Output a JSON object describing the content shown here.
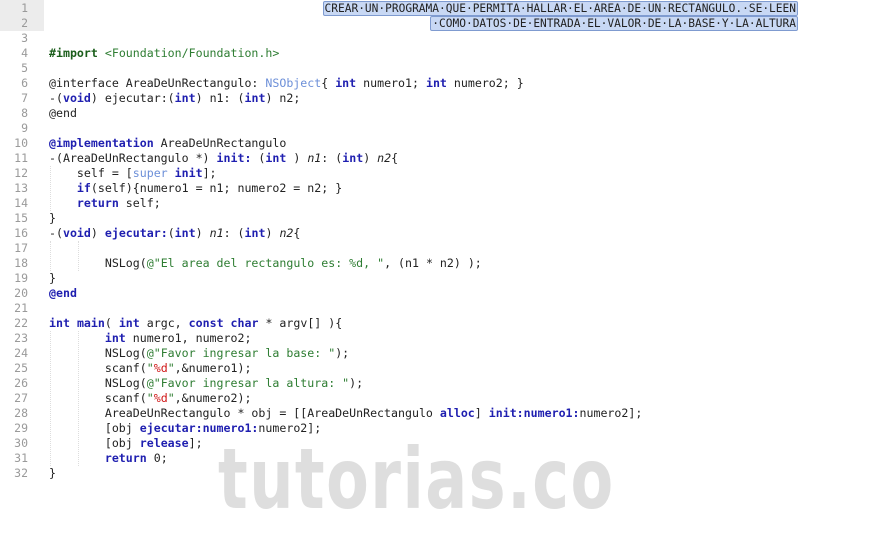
{
  "editor": {
    "header_comment": [
      "CREAR·UN·PROGRAMA·QUE·PERMITA·HALLAR·EL·AREA·DE·UN·RECTANGULO.·SE·LEEN",
      "·COMO·DATOS·DE·ENTRADA·EL·VALOR·DE·LA·BASE·Y·LA·ALTURA"
    ],
    "colors": {
      "keyword": "#1f1fb0",
      "string": "#2e7d32",
      "type": "#6c8fd8",
      "format": "#d01515",
      "comment_bg": "#c8d8f4"
    },
    "lines": [
      {
        "n": "1",
        "tokens": []
      },
      {
        "n": "2",
        "tokens": []
      },
      {
        "n": "3",
        "tokens": []
      },
      {
        "n": "4",
        "tokens": [
          [
            "p",
            "#import"
          ],
          [
            "",
            ""
          ],
          [
            "s",
            " <Foundation/Foundation.h>"
          ]
        ]
      },
      {
        "n": "5",
        "tokens": []
      },
      {
        "n": "6",
        "tokens": [
          [
            "",
            "@interface AreaDeUnRectangulo: "
          ],
          [
            "t",
            "NSObject"
          ],
          [
            "",
            "{ "
          ],
          [
            "k",
            "int"
          ],
          [
            "",
            " numero1; "
          ],
          [
            "k",
            "int"
          ],
          [
            "",
            " numero2; }"
          ]
        ]
      },
      {
        "n": "7",
        "tokens": [
          [
            "",
            "-("
          ],
          [
            "k",
            "void"
          ],
          [
            "",
            ") ejecutar:("
          ],
          [
            "k",
            "int"
          ],
          [
            "",
            ") n1: ("
          ],
          [
            "k",
            "int"
          ],
          [
            "",
            ") n2;"
          ]
        ]
      },
      {
        "n": "8",
        "tokens": [
          [
            "",
            "@end"
          ]
        ]
      },
      {
        "n": "9",
        "tokens": []
      },
      {
        "n": "10",
        "tokens": [
          [
            "k",
            "@implementation"
          ],
          [
            "",
            " AreaDeUnRectangulo"
          ]
        ]
      },
      {
        "n": "11",
        "tokens": [
          [
            "",
            "-(AreaDeUnRectangulo *) "
          ],
          [
            "k",
            "init:"
          ],
          [
            "",
            " ("
          ],
          [
            "k",
            "int"
          ],
          [
            "",
            " ) "
          ],
          [
            "i",
            "n1"
          ],
          [
            "",
            ": ("
          ],
          [
            "k",
            "int"
          ],
          [
            "",
            ") "
          ],
          [
            "i",
            "n2"
          ],
          [
            "",
            "{"
          ]
        ]
      },
      {
        "n": "12",
        "tokens": [
          [
            "",
            "    self = ["
          ],
          [
            "t",
            "super"
          ],
          [
            "",
            " "
          ],
          [
            "k",
            "init"
          ],
          [
            "",
            "];"
          ]
        ]
      },
      {
        "n": "13",
        "tokens": [
          [
            "",
            "    "
          ],
          [
            "k",
            "if"
          ],
          [
            "",
            "(self){numero1 = n1; numero2 = n2; }"
          ]
        ]
      },
      {
        "n": "14",
        "tokens": [
          [
            "",
            "    "
          ],
          [
            "k",
            "return"
          ],
          [
            "",
            " self;"
          ]
        ]
      },
      {
        "n": "15",
        "tokens": [
          [
            "",
            "}"
          ]
        ]
      },
      {
        "n": "16",
        "tokens": [
          [
            "",
            "-("
          ],
          [
            "k",
            "void"
          ],
          [
            "",
            ") "
          ],
          [
            "k",
            "ejecutar:"
          ],
          [
            "",
            "("
          ],
          [
            "k",
            "int"
          ],
          [
            "",
            ") "
          ],
          [
            "i",
            "n1"
          ],
          [
            "",
            ": ("
          ],
          [
            "k",
            "int"
          ],
          [
            "",
            ") "
          ],
          [
            "i",
            "n2"
          ],
          [
            "",
            "{"
          ]
        ]
      },
      {
        "n": "17",
        "tokens": []
      },
      {
        "n": "18",
        "tokens": [
          [
            "",
            "        NSLog("
          ],
          [
            "s",
            "@\"El area del rectangulo es: %d, \""
          ],
          [
            "",
            ", (n1 * n2) );"
          ]
        ]
      },
      {
        "n": "19",
        "tokens": [
          [
            "",
            "}"
          ]
        ]
      },
      {
        "n": "20",
        "tokens": [
          [
            "k",
            "@end"
          ]
        ]
      },
      {
        "n": "21",
        "tokens": []
      },
      {
        "n": "22",
        "tokens": [
          [
            "k",
            "int"
          ],
          [
            "",
            " "
          ],
          [
            "k",
            "main"
          ],
          [
            "",
            "( "
          ],
          [
            "k",
            "int"
          ],
          [
            "",
            " argc, "
          ],
          [
            "k",
            "const"
          ],
          [
            "",
            " "
          ],
          [
            "k",
            "char"
          ],
          [
            "",
            " * argv[] ){"
          ]
        ]
      },
      {
        "n": "23",
        "tokens": [
          [
            "",
            "        "
          ],
          [
            "k",
            "int"
          ],
          [
            "",
            " numero1, numero2;"
          ]
        ]
      },
      {
        "n": "24",
        "tokens": [
          [
            "",
            "        NSLog("
          ],
          [
            "s",
            "@\"Favor ingresar la base: \""
          ],
          [
            "",
            ");"
          ]
        ]
      },
      {
        "n": "25",
        "tokens": [
          [
            "",
            "        scanf("
          ],
          [
            "s",
            "\""
          ],
          [
            "f",
            "%d"
          ],
          [
            "s",
            "\""
          ],
          [
            "",
            ",&numero1);"
          ]
        ]
      },
      {
        "n": "26",
        "tokens": [
          [
            "",
            "        NSLog("
          ],
          [
            "s",
            "@\"Favor ingresar la altura: \""
          ],
          [
            "",
            ");"
          ]
        ]
      },
      {
        "n": "27",
        "tokens": [
          [
            "",
            "        scanf("
          ],
          [
            "s",
            "\""
          ],
          [
            "f",
            "%d"
          ],
          [
            "s",
            "\""
          ],
          [
            "",
            ",&numero2);"
          ]
        ]
      },
      {
        "n": "28",
        "tokens": [
          [
            "",
            "        AreaDeUnRectangulo * obj = [[AreaDeUnRectangulo "
          ],
          [
            "k",
            "alloc"
          ],
          [
            "",
            "] "
          ],
          [
            "k",
            "init:numero1:"
          ],
          [
            "",
            "numero2];"
          ]
        ]
      },
      {
        "n": "29",
        "tokens": [
          [
            "",
            "        [obj "
          ],
          [
            "k",
            "ejecutar:numero1:"
          ],
          [
            "",
            "numero2];"
          ]
        ]
      },
      {
        "n": "30",
        "tokens": [
          [
            "",
            "        [obj "
          ],
          [
            "k",
            "release"
          ],
          [
            "",
            "];"
          ]
        ]
      },
      {
        "n": "31",
        "tokens": [
          [
            "",
            "        "
          ],
          [
            "k",
            "return"
          ],
          [
            "",
            " 0;"
          ]
        ]
      },
      {
        "n": "32",
        "tokens": [
          [
            "",
            "}"
          ]
        ]
      }
    ]
  },
  "watermark": "tutorias.co"
}
